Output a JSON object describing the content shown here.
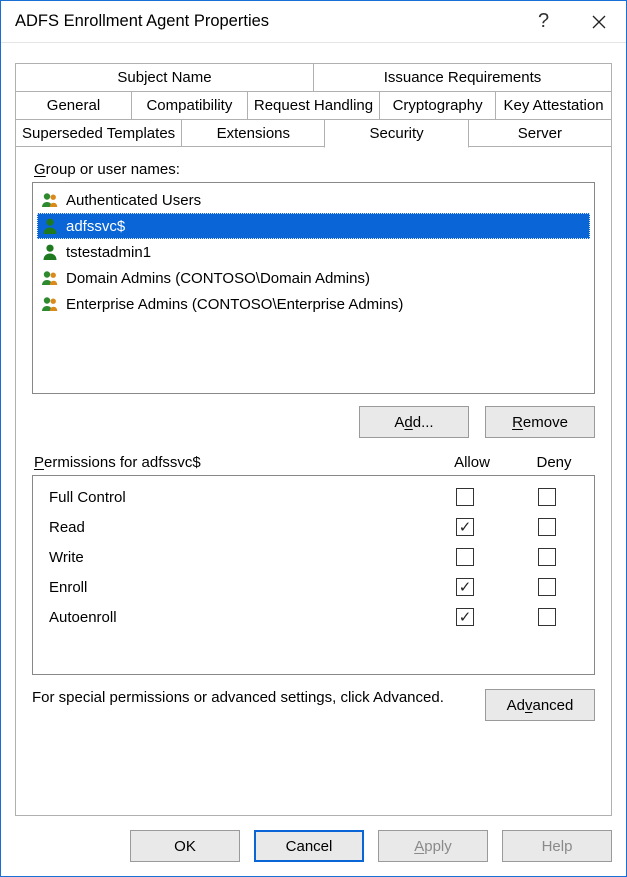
{
  "window": {
    "title": "ADFS Enrollment Agent Properties"
  },
  "tabs": {
    "row1": [
      "Subject Name",
      "Issuance Requirements"
    ],
    "row2": [
      "General",
      "Compatibility",
      "Request Handling",
      "Cryptography",
      "Key Attestation"
    ],
    "row3": [
      "Superseded Templates",
      "Extensions",
      "Security",
      "Server"
    ],
    "activeRow": 3,
    "activeIndex": 2
  },
  "security": {
    "group_label": "Group or user names:",
    "users": [
      {
        "icon": "group",
        "name": "Authenticated Users",
        "selected": false
      },
      {
        "icon": "user",
        "name": "adfssvc$",
        "selected": true
      },
      {
        "icon": "user",
        "name": "tstestadmin1",
        "selected": false
      },
      {
        "icon": "group",
        "name": "Domain Admins (CONTOSO\\Domain Admins)",
        "selected": false
      },
      {
        "icon": "group",
        "name": "Enterprise Admins (CONTOSO\\Enterprise Admins)",
        "selected": false
      }
    ],
    "add_label": "Add...",
    "remove_label": "Remove",
    "perms_label": "Permissions for adfssvc$",
    "col_allow": "Allow",
    "col_deny": "Deny",
    "permissions": [
      {
        "name": "Full Control",
        "allow": false,
        "deny": false
      },
      {
        "name": "Read",
        "allow": true,
        "deny": false
      },
      {
        "name": "Write",
        "allow": false,
        "deny": false
      },
      {
        "name": "Enroll",
        "allow": true,
        "deny": false
      },
      {
        "name": "Autoenroll",
        "allow": true,
        "deny": false
      }
    ],
    "advanced_text": "For special permissions or advanced settings, click Advanced.",
    "advanced_label": "Advanced"
  },
  "buttons": {
    "ok": "OK",
    "cancel": "Cancel",
    "apply": "Apply",
    "help": "Help"
  }
}
